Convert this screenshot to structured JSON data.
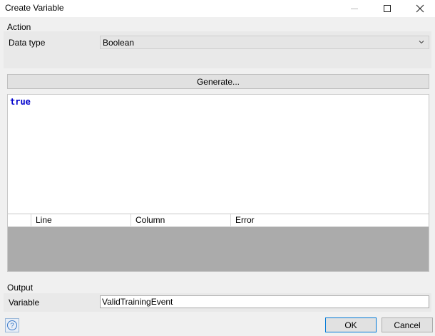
{
  "window": {
    "title": "Create Variable"
  },
  "action": {
    "group_label": "Action",
    "data_type_label": "Data type",
    "data_type_value": "Boolean"
  },
  "generate_label": "Generate...",
  "editor": {
    "code": "true",
    "keyword_color": "#0000cc"
  },
  "error_table": {
    "columns": [
      "",
      "Line",
      "Column",
      "Error"
    ]
  },
  "output": {
    "group_label": "Output",
    "variable_label": "Variable",
    "variable_value": "ValidTrainingEvent"
  },
  "buttons": {
    "ok": "OK",
    "cancel": "Cancel"
  },
  "icons": {
    "minimize": "minimize-icon",
    "maximize": "maximize-icon",
    "close": "close-icon",
    "dropdown": "chevron-down-icon",
    "help": "help-icon"
  }
}
